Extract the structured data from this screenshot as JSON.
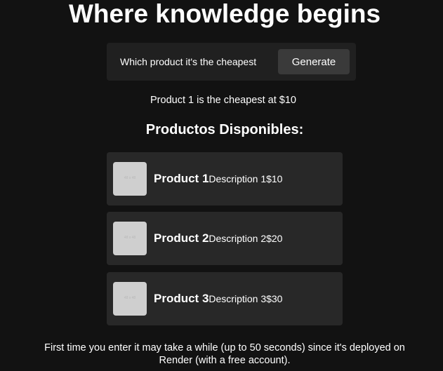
{
  "header": {
    "title": "Where knowledge begins"
  },
  "query": {
    "value": "Which product it's the cheapest",
    "generate_label": "Generate"
  },
  "answer": {
    "text": "Product 1 is the cheapest at $10"
  },
  "products": {
    "heading": "Productos Disponibles:",
    "items": [
      {
        "name": "Product 1",
        "description": "Description 1",
        "price": "$10",
        "image_text": "48 x 48"
      },
      {
        "name": "Product 2",
        "description": "Description 2",
        "price": "$20",
        "image_text": "48 x 48"
      },
      {
        "name": "Product 3",
        "description": "Description 3",
        "price": "$30",
        "image_text": "48 x 48"
      }
    ]
  },
  "footer": {
    "note": "First time you enter it may take a while (up to 50 seconds) since it's deployed on Render (with a free account)."
  }
}
